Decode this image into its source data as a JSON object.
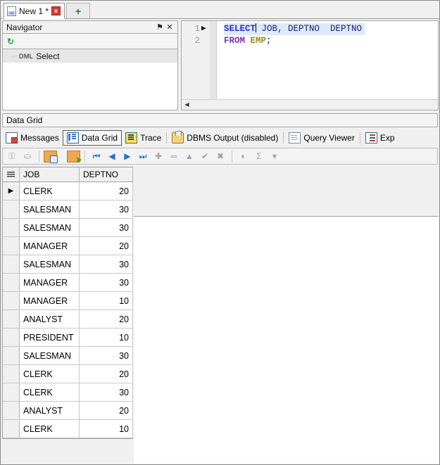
{
  "window": {
    "doc_tab": {
      "icon": "sql-file-icon",
      "label": "New 1 *",
      "close_label": "x",
      "add_label": "+"
    }
  },
  "navigator": {
    "title": "Navigator",
    "pin_glyph": "⚑",
    "close_glyph": "✕",
    "refresh_glyph": "↻",
    "tree": [
      {
        "dots": "···",
        "prefix": "DML",
        "label": "Select"
      }
    ]
  },
  "editor": {
    "lines": [
      {
        "number": "1",
        "marker": "▶"
      },
      {
        "number": "2",
        "marker": ""
      }
    ],
    "line1": {
      "keyword": "SELECT",
      "columns": " JOB, DEPTNO  DEPTNO"
    },
    "line2": {
      "keyword": "FROM",
      "table": " EMP",
      "terminator": ";"
    },
    "scroll_left_glyph": "◀"
  },
  "data_grid_caption": "Data Grid",
  "result_tabs": [
    {
      "icon": "messages-icon",
      "label": "Messages",
      "active": false
    },
    {
      "icon": "data-grid-icon",
      "label": "Data Grid",
      "active": true
    },
    {
      "icon": "trace-icon",
      "label": "Trace",
      "active": false
    },
    {
      "icon": "dbms-output-icon",
      "label": "DBMS Output (disabled)",
      "active": false
    },
    {
      "icon": "query-viewer-icon",
      "label": "Query Viewer",
      "active": false
    },
    {
      "icon": "explain-plan-icon",
      "label": "Exp",
      "active": false
    }
  ],
  "grid_toolbar": [
    {
      "name": "import-data-button",
      "glyph": "",
      "state": "disabled"
    },
    {
      "name": "export-data-button",
      "glyph": "",
      "state": "disabled"
    },
    {
      "name": "single-record-view-button",
      "glyph": "",
      "state": "enabled"
    },
    {
      "name": "grid-to-editor-button",
      "glyph": "",
      "state": "enabled"
    },
    {
      "name": "first-record-button",
      "glyph": "⏮",
      "state": "enabled"
    },
    {
      "name": "previous-record-button",
      "glyph": "◀",
      "state": "enabled"
    },
    {
      "name": "next-record-button",
      "glyph": "▶",
      "state": "enabled"
    },
    {
      "name": "last-record-button",
      "glyph": "⏭",
      "state": "enabled"
    },
    {
      "name": "insert-record-button",
      "glyph": "✚",
      "state": "disabled"
    },
    {
      "name": "delete-record-button",
      "glyph": "═",
      "state": "disabled"
    },
    {
      "name": "edit-record-button",
      "glyph": "▲",
      "state": "disabled"
    },
    {
      "name": "post-edit-button",
      "glyph": "✔",
      "state": "disabled"
    },
    {
      "name": "cancel-edit-button",
      "glyph": "✖",
      "state": "disabled"
    },
    {
      "name": "filter-button",
      "glyph": "",
      "state": "disabled"
    },
    {
      "name": "aggregate-button",
      "glyph": "Σ",
      "state": "disabled"
    },
    {
      "name": "aggregate-dropdown-button",
      "glyph": "▾",
      "state": "enabled"
    }
  ],
  "grid": {
    "columns": [
      "JOB",
      "DEPTNO"
    ],
    "current_row_marker": "▶",
    "rows": [
      {
        "JOB": "CLERK",
        "DEPTNO": "20",
        "current": true
      },
      {
        "JOB": "SALESMAN",
        "DEPTNO": "30",
        "current": false
      },
      {
        "JOB": "SALESMAN",
        "DEPTNO": "30",
        "current": false
      },
      {
        "JOB": "MANAGER",
        "DEPTNO": "20",
        "current": false
      },
      {
        "JOB": "SALESMAN",
        "DEPTNO": "30",
        "current": false
      },
      {
        "JOB": "MANAGER",
        "DEPTNO": "30",
        "current": false
      },
      {
        "JOB": "MANAGER",
        "DEPTNO": "10",
        "current": false
      },
      {
        "JOB": "ANALYST",
        "DEPTNO": "20",
        "current": false
      },
      {
        "JOB": "PRESIDENT",
        "DEPTNO": "10",
        "current": false
      },
      {
        "JOB": "SALESMAN",
        "DEPTNO": "30",
        "current": false
      },
      {
        "JOB": "CLERK",
        "DEPTNO": "20",
        "current": false
      },
      {
        "JOB": "CLERK",
        "DEPTNO": "30",
        "current": false
      },
      {
        "JOB": "ANALYST",
        "DEPTNO": "20",
        "current": false
      },
      {
        "JOB": "CLERK",
        "DEPTNO": "10",
        "current": false
      }
    ]
  },
  "colors": {
    "keyword": "#2d30c8",
    "keyword_from": "#7a2fb0",
    "identifier": "#1b1b7a",
    "table": "#9a8a22",
    "selection": "#ddeaf8",
    "accent_blue": "#1f6fd0",
    "close_red": "#d03a33"
  }
}
